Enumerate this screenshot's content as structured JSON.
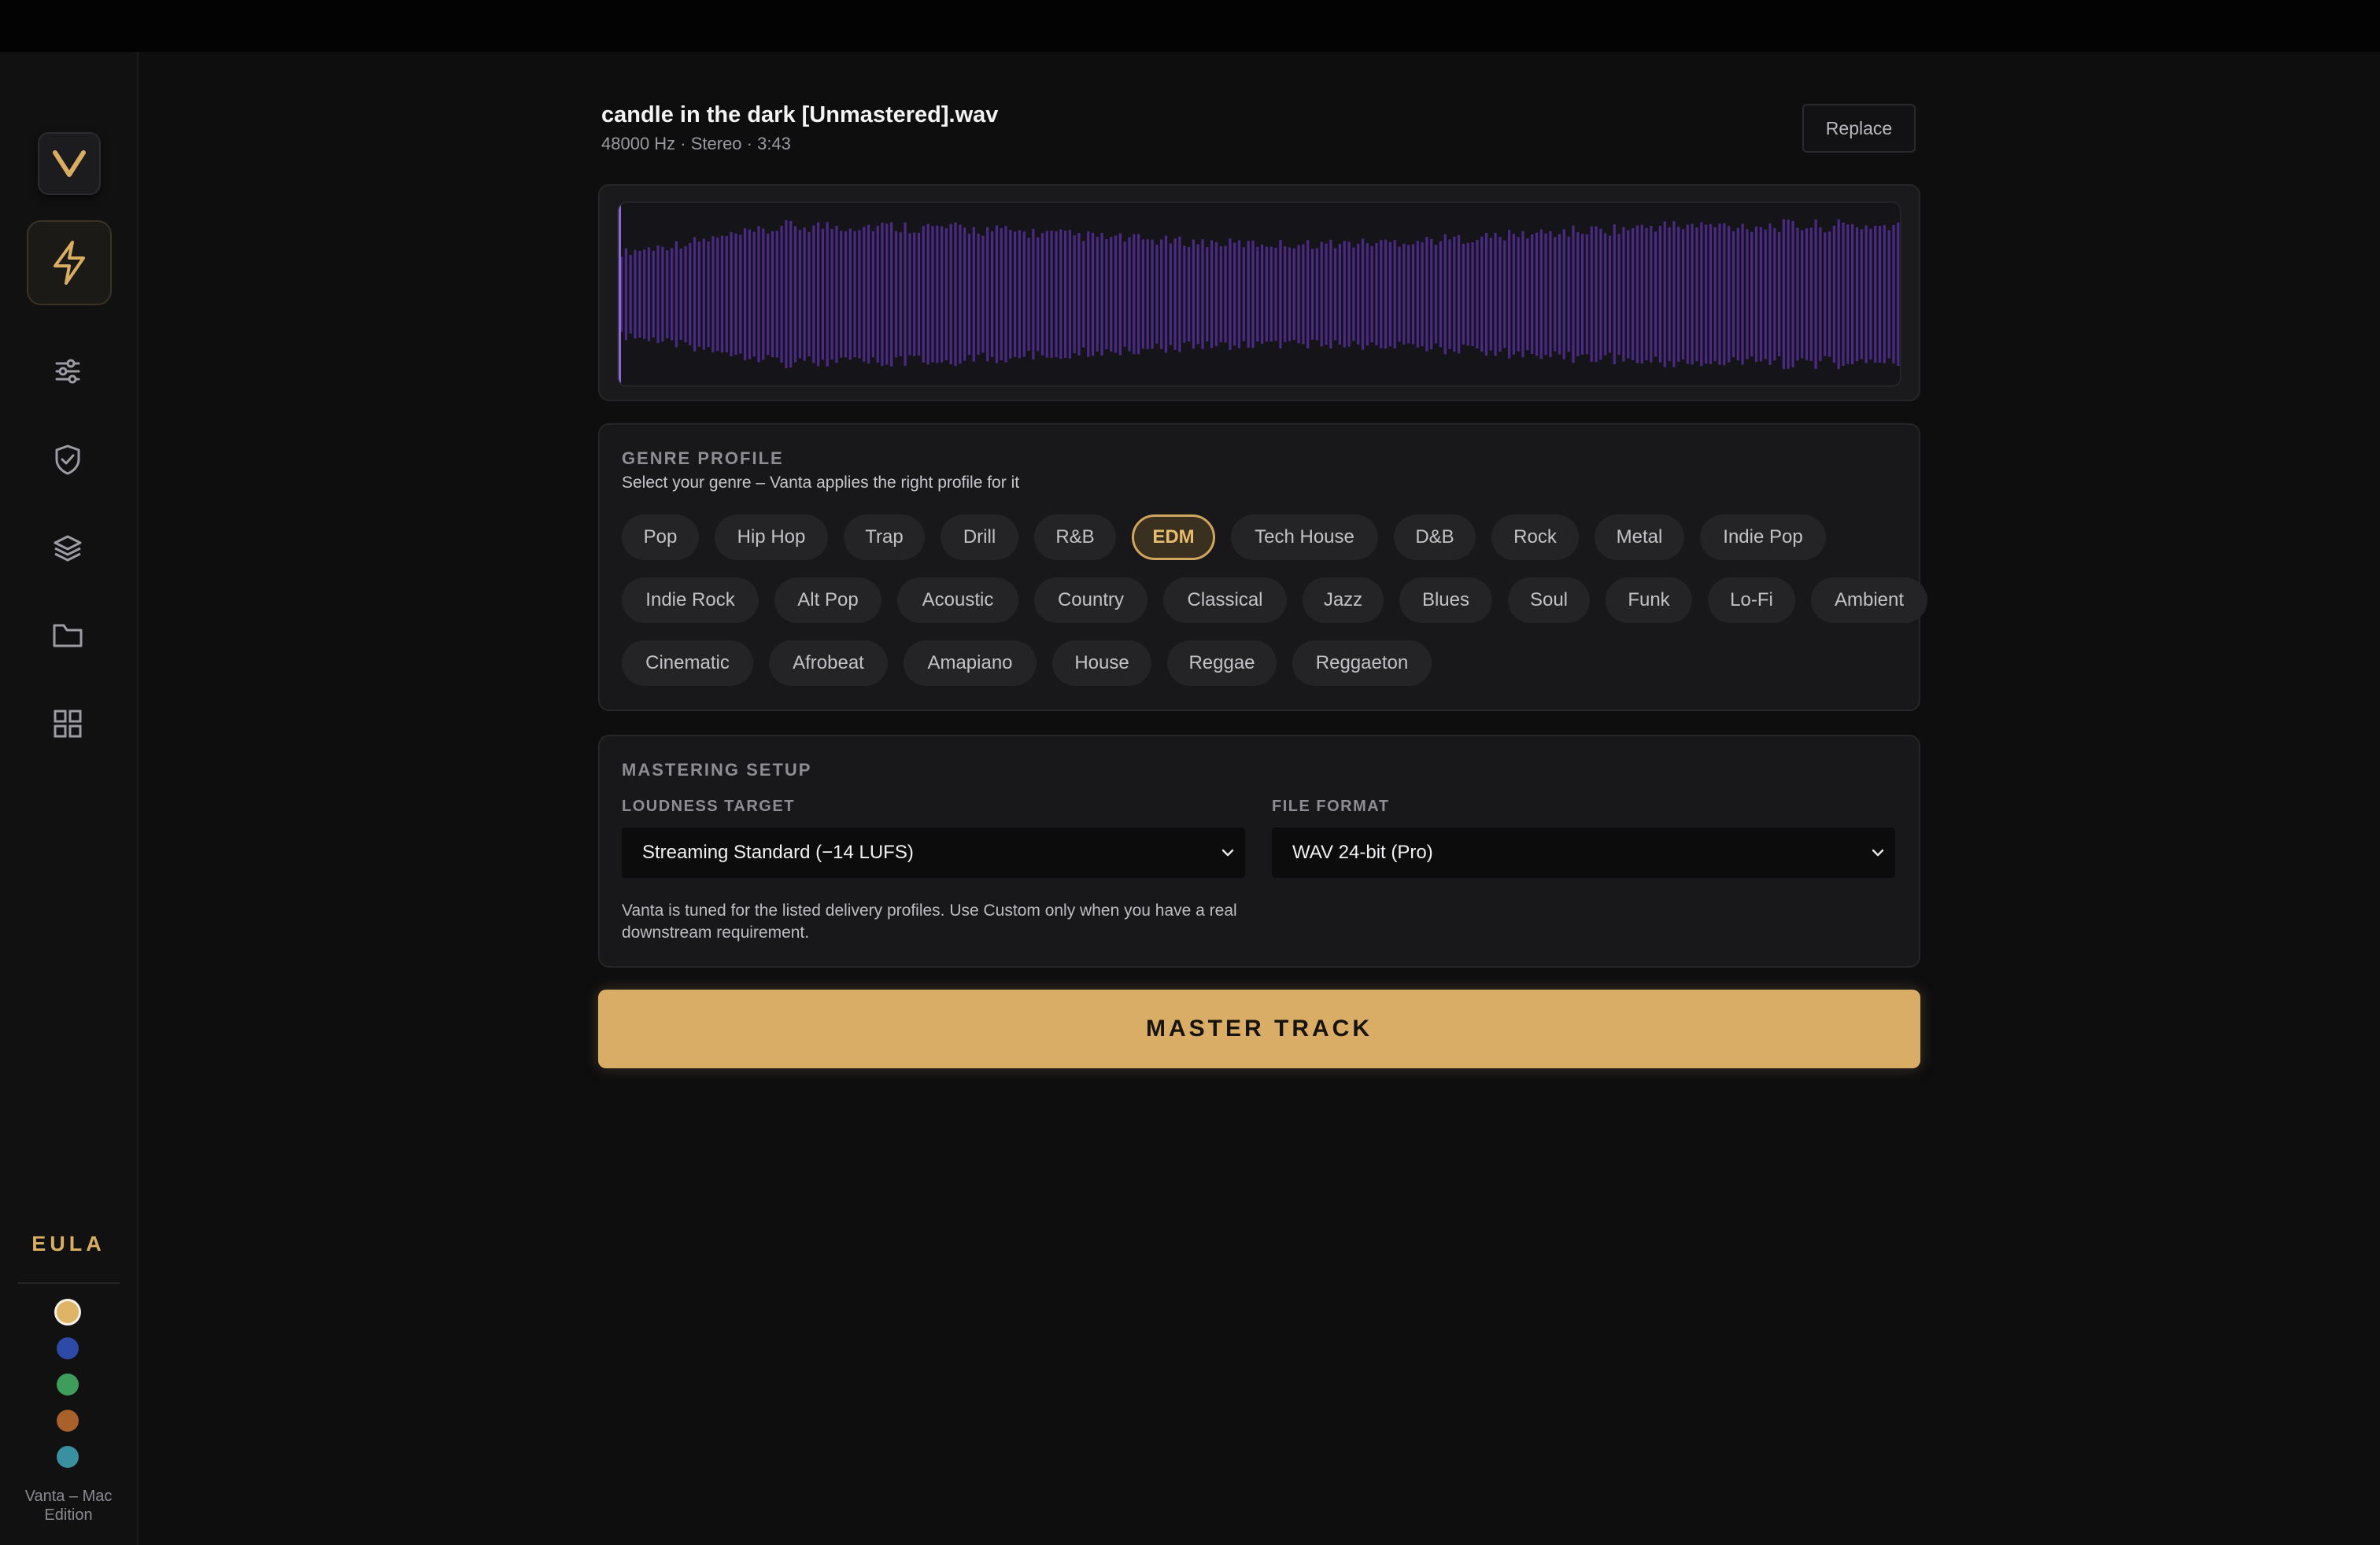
{
  "app": {
    "logo_letter": "V",
    "edition": "Vanta – Mac Edition"
  },
  "sidebar": {
    "items": [
      {
        "icon": "bolt-icon",
        "active": true
      },
      {
        "icon": "sliders-icon",
        "active": false
      },
      {
        "icon": "shield-check-icon",
        "active": false
      },
      {
        "icon": "layers-icon",
        "active": false
      },
      {
        "icon": "folder-icon",
        "active": false
      },
      {
        "icon": "grid-icon",
        "active": false
      }
    ],
    "eula_label": "EULA",
    "theme_swatches": [
      "#e0b466",
      "#2c4aa6",
      "#3f9d5c",
      "#a8612a",
      "#3a8fa0"
    ]
  },
  "track": {
    "title": "candle in the dark [Unmastered].wav",
    "meta": "48000 Hz · Stereo · 3:43",
    "replace_label": "Replace"
  },
  "genre": {
    "title": "GENRE PROFILE",
    "subtitle": "Select your genre – Vanta applies the right profile for it",
    "selected": "EDM",
    "rows": [
      [
        "Pop",
        "Hip Hop",
        "Trap",
        "Drill",
        "R&B",
        "EDM",
        "Tech House",
        "D&B",
        "Rock",
        "Metal",
        "Indie Pop"
      ],
      [
        "Indie Rock",
        "Alt Pop",
        "Acoustic",
        "Country",
        "Classical",
        "Jazz",
        "Blues",
        "Soul",
        "Funk",
        "Lo-Fi",
        "Ambient"
      ],
      [
        "Cinematic",
        "Afrobeat",
        "Amapiano",
        "House",
        "Reggae",
        "Reggaeton"
      ]
    ]
  },
  "setup": {
    "title": "MASTERING SETUP",
    "loudness_label": "LOUDNESS TARGET",
    "loudness_value": "Streaming Standard (−14 LUFS)",
    "format_label": "FILE FORMAT",
    "format_value": "WAV 24-bit (Pro)",
    "note": "Vanta is tuned for the listed delivery profiles. Use Custom only when you have a real downstream requirement."
  },
  "master_button_label": "MASTER TRACK",
  "colors": {
    "accent": "#d9ad66",
    "waveform": "#4a2a86",
    "playhead": "#8c6ad8"
  }
}
